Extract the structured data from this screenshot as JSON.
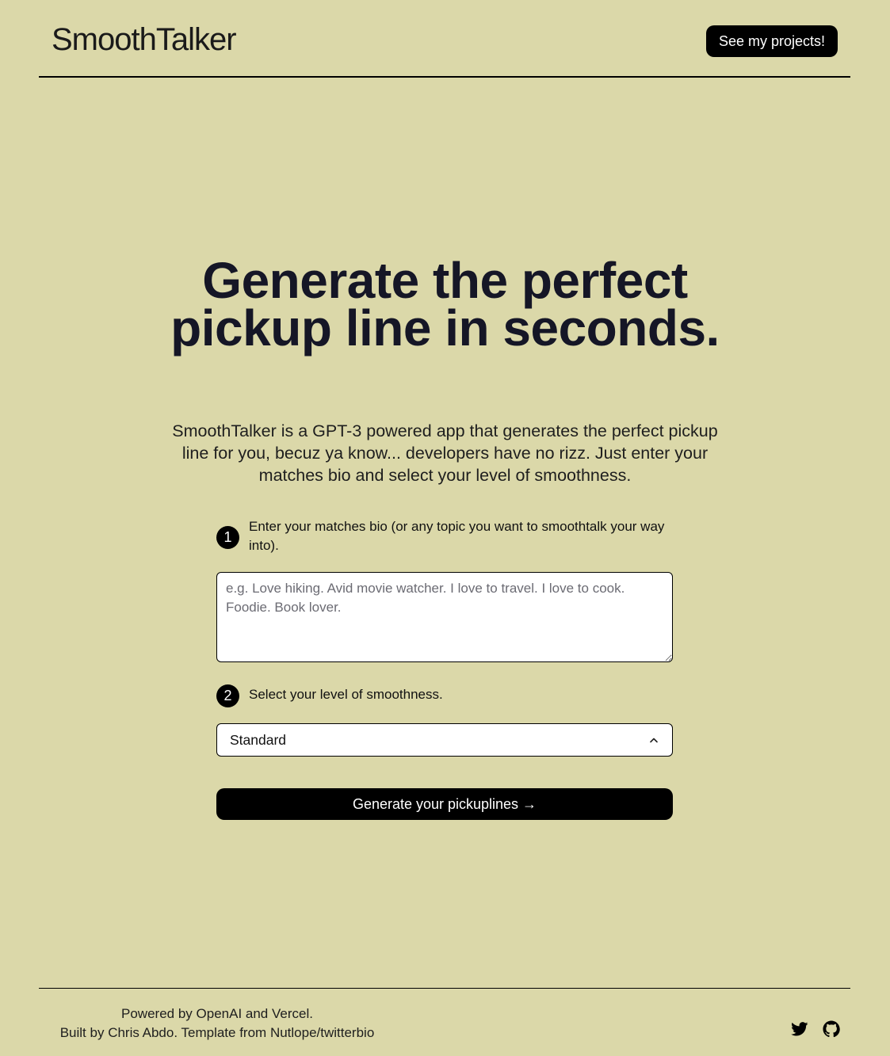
{
  "header": {
    "logo": "SmoothTalker",
    "projects_button": "See my projects!"
  },
  "hero": {
    "title": "Generate the perfect pickup line in seconds.",
    "subtitle": "SmoothTalker is a GPT-3 powered app that generates the perfect pickup line for you, becuz ya know... developers have no rizz. Just enter your matches bio and select your level of smoothness."
  },
  "form": {
    "step1": {
      "number": "1",
      "label_main": "Enter your matches bio",
      "label_rest": " (or any topic you want to smoothtalk your way into)."
    },
    "bio_placeholder": "e.g. Love hiking. Avid movie watcher. I love to travel. I love to cook. Foodie. Book lover.",
    "bio_value": "",
    "step2": {
      "number": "2",
      "label": "Select your level of smoothness."
    },
    "smoothness_selected": "Standard",
    "generate_button": "Generate your pickuplines →"
  },
  "footer": {
    "powered_prefix": "Powered by ",
    "openai": "OpenAI",
    "and": " and ",
    "vercel": "Vercel",
    "period": ".",
    "built_prefix": "Built by ",
    "author": "Chris Abdo",
    "template_prefix": ". Template from ",
    "template": "Nutlope/twitterbio"
  },
  "icons": {
    "twitter": "twitter-icon",
    "github": "github-icon",
    "chevron": "chevron-up-icon"
  },
  "colors": {
    "background": "#dbd8a9",
    "button": "#000000",
    "title": "#151626"
  }
}
